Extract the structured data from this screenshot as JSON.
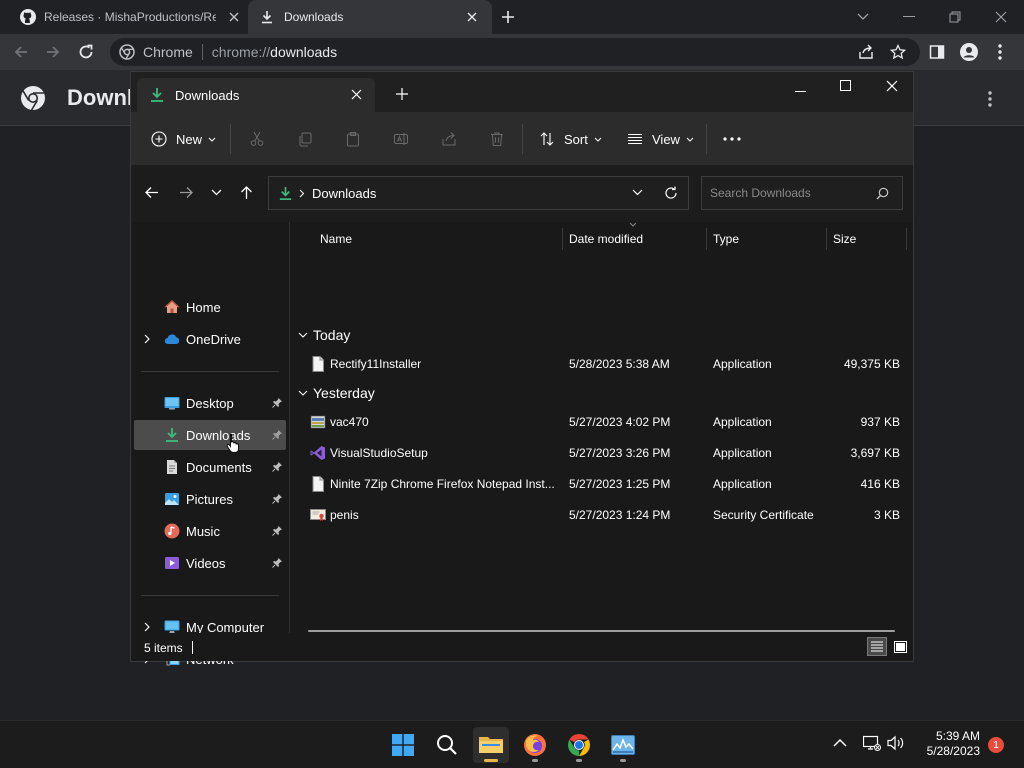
{
  "chrome": {
    "tabs": [
      {
        "title": "Releases · MishaProductions/Rec",
        "active": false
      },
      {
        "title": "Downloads",
        "active": true
      }
    ],
    "omnibox": {
      "host": "Chrome",
      "scheme": "chrome://",
      "path": "downloads"
    },
    "page_title": "Downl"
  },
  "explorer": {
    "tab_title": "Downloads",
    "commands": {
      "new": "New",
      "sort": "Sort",
      "view": "View"
    },
    "address": {
      "location": "Downloads"
    },
    "search": {
      "placeholder": "Search Downloads"
    },
    "nav": {
      "home": "Home",
      "onedrive": "OneDrive",
      "desktop": "Desktop",
      "downloads": "Downloads",
      "documents": "Documents",
      "pictures": "Pictures",
      "music": "Music",
      "videos": "Videos",
      "my_computer": "My Computer",
      "network": "Network"
    },
    "columns": {
      "name": "Name",
      "date": "Date modified",
      "type": "Type",
      "size": "Size"
    },
    "groups": {
      "today": {
        "label": "Today",
        "files": [
          {
            "name": "Rectify11Installer",
            "date": "5/28/2023 5:38 AM",
            "type": "Application",
            "size": "49,375 KB",
            "icon": "file-icon"
          }
        ]
      },
      "yesterday": {
        "label": "Yesterday",
        "files": [
          {
            "name": "vac470",
            "date": "5/27/2023 4:02 PM",
            "type": "Application",
            "size": "937 KB",
            "icon": "installer-icon"
          },
          {
            "name": "VisualStudioSetup",
            "date": "5/27/2023 3:26 PM",
            "type": "Application",
            "size": "3,697 KB",
            "icon": "visual-studio-icon"
          },
          {
            "name": "Ninite 7Zip Chrome Firefox Notepad Inst...",
            "date": "5/27/2023 1:25 PM",
            "type": "Application",
            "size": "416 KB",
            "icon": "file-icon"
          },
          {
            "name": "penis",
            "date": "5/27/2023 1:24 PM",
            "type": "Security Certificate",
            "size": "3 KB",
            "icon": "certificate-icon"
          }
        ]
      }
    },
    "status": {
      "items": "5 items"
    }
  },
  "taskbar": {
    "time": "5:39 AM",
    "date": "5/28/2023",
    "notifications": "1"
  },
  "colors": {
    "accent": "#0078d4",
    "folder": "#e8b64b",
    "download_green": "#3dbb7f",
    "notification": "#e74c3c"
  }
}
